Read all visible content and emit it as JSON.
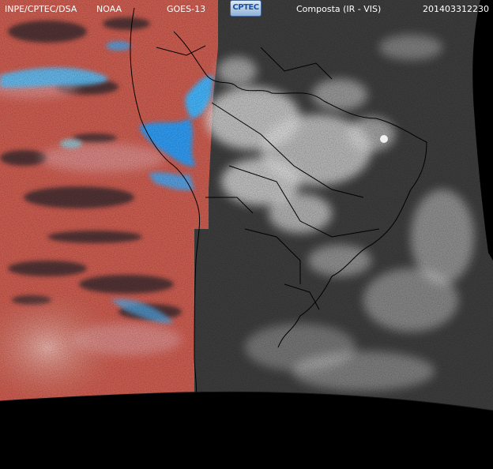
{
  "header": {
    "institution": "INPE/CPTEC/DSA",
    "agency": "NOAA",
    "satellite": "GOES-13",
    "logo_text": "CPTEC",
    "product": "Composta (IR - VIS)",
    "timestamp": "201403312230"
  },
  "colors": {
    "ir_background": "#c85a4c",
    "vis_background": "#3a3a3a",
    "cold_cloud": "#3aa2ee",
    "space": "#000000",
    "borders": "#000000"
  }
}
